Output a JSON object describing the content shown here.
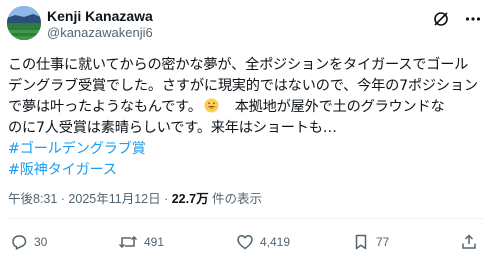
{
  "author": {
    "display_name": "Kenji Kanazawa",
    "handle": "@kanazawakenji6",
    "avatar_icon": "avatar-stadium-icon"
  },
  "top_actions": {
    "grok_icon": "grok-icon",
    "more_icon": "more-options-icon"
  },
  "post": {
    "lines": [
      "この仕事に就いてからの密かな夢が、全ポジションをタイガースでゴール",
      "デングラブ受賞でした。さすがに現実的ではないので、今年の7ポジション"
    ],
    "line3_before_emoji": "で夢は叶ったようなもんです。",
    "emoji": "grinning-face-emoji",
    "line3_after_emoji": "　本拠地が屋外で土のグラウンドな",
    "line4": "のに7人受賞は素晴らしいです。来年はショートも…",
    "hashtags": [
      "#ゴールデングラブ賞",
      "#阪神タイガース"
    ],
    "hashtag_color": "#1d9bf0"
  },
  "meta": {
    "time_date": "午後8:31 · 2025年11月12日 · ",
    "views_count": "22.7万",
    "views_label": " 件の表示"
  },
  "actions": {
    "reply_count": "30",
    "repost_count": "491",
    "like_count": "4,419",
    "bookmark_count": "77"
  },
  "colors": {
    "text": "#0f1419",
    "muted": "#536471",
    "accent": "#1d9bf0"
  }
}
